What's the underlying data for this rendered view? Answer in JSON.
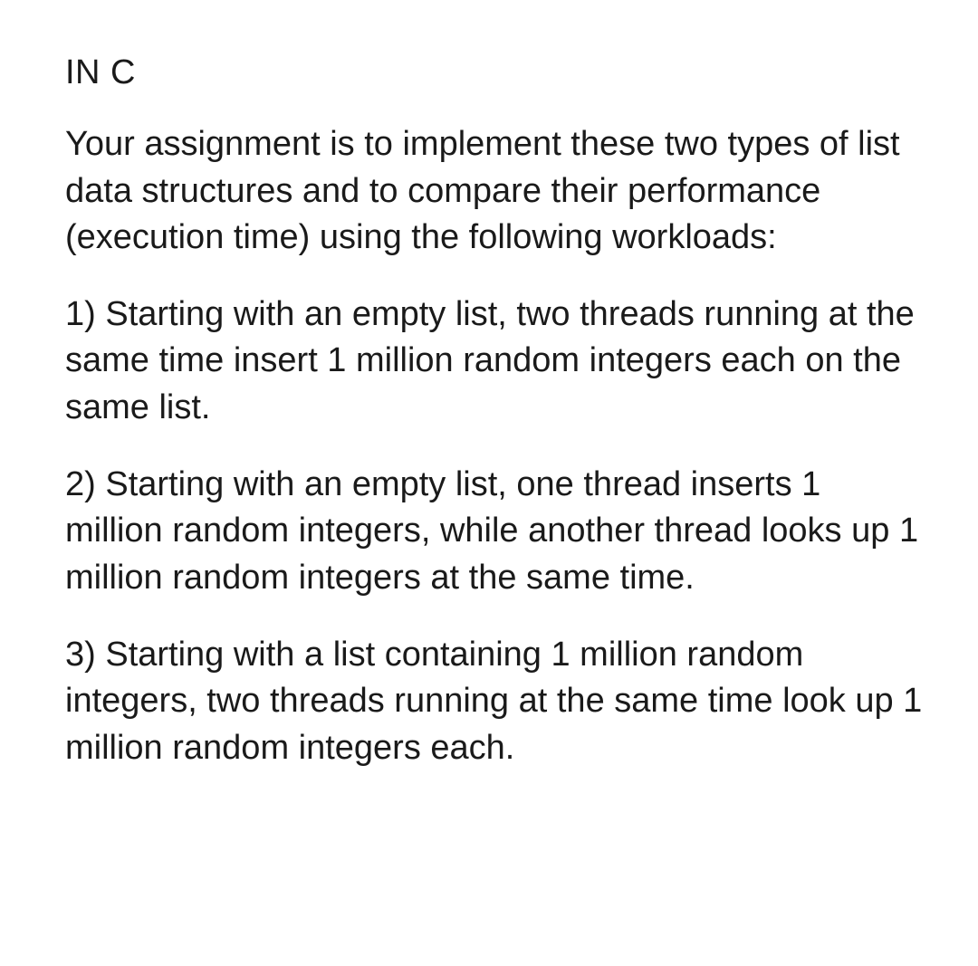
{
  "heading": "IN C",
  "intro": "Your assignment is to implement these two types of list data structures and to compare their performance (execution time) using the following workloads:",
  "items": [
    "1) Starting with an empty list, two threads running at the same time insert 1 million random integers each on the same list.",
    "2) Starting with an empty list, one thread inserts 1 million random integers, while another thread looks up 1 million random integers at the same time.",
    "3) Starting with a list containing 1 million random integers, two threads running at the same time look up 1 million random integers each."
  ]
}
